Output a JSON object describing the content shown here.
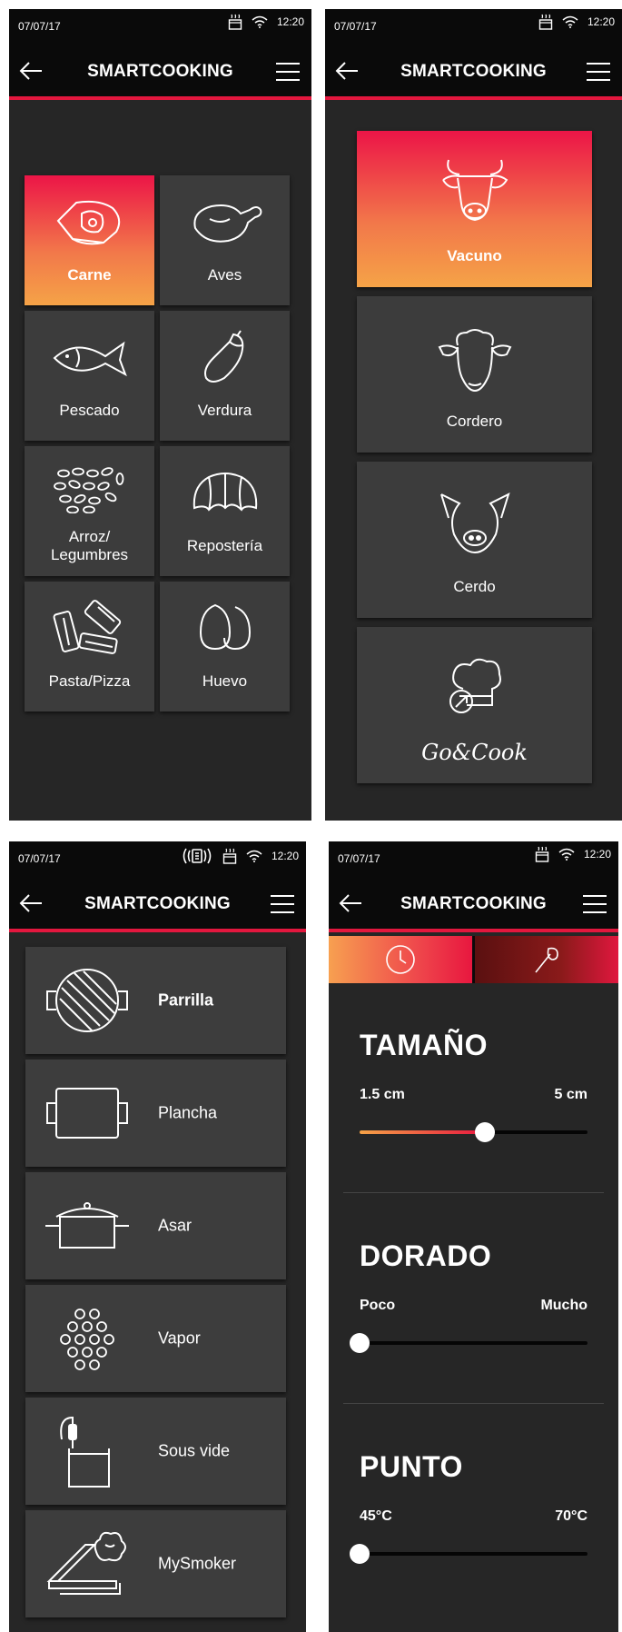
{
  "status": {
    "date": "07/07/17",
    "time": "12:20"
  },
  "appbar": {
    "title": "SMARTCOOKING"
  },
  "categories": {
    "items": [
      {
        "label": "Carne",
        "icon": "meat-icon",
        "selected": true
      },
      {
        "label": "Aves",
        "icon": "chicken-icon"
      },
      {
        "label": "Pescado",
        "icon": "fish-icon"
      },
      {
        "label": "Verdura",
        "icon": "eggplant-icon"
      },
      {
        "label": "Arroz/\nLegumbres",
        "icon": "rice-icon"
      },
      {
        "label": "Repostería",
        "icon": "croissant-icon"
      },
      {
        "label": "Pasta/Pizza",
        "icon": "pasta-icon"
      },
      {
        "label": "Huevo",
        "icon": "egg-icon"
      }
    ]
  },
  "meat_types": {
    "items": [
      {
        "label": "Vacuno",
        "icon": "cow-icon",
        "selected": true
      },
      {
        "label": "Cordero",
        "icon": "sheep-icon"
      },
      {
        "label": "Cerdo",
        "icon": "pig-icon"
      },
      {
        "label": "Go&Cook",
        "icon": "chef-hat-icon"
      }
    ]
  },
  "methods": {
    "items": [
      {
        "label": "Parrilla",
        "icon": "grill-icon",
        "selected": true
      },
      {
        "label": "Plancha",
        "icon": "griddle-icon"
      },
      {
        "label": "Asar",
        "icon": "roasting-pot-icon"
      },
      {
        "label": "Vapor",
        "icon": "steam-icon"
      },
      {
        "label": "Sous vide",
        "icon": "sous-vide-icon"
      },
      {
        "label": "MySmoker",
        "icon": "smoker-icon"
      }
    ]
  },
  "settings": {
    "tabs": [
      {
        "icon": "timer-icon",
        "active": true
      },
      {
        "icon": "probe-icon",
        "active": false
      }
    ],
    "sliders": [
      {
        "title": "TAMAÑO",
        "min": "1.5 cm",
        "max": "5 cm",
        "level": 0.55
      },
      {
        "title": "DORADO",
        "min": "Poco",
        "max": "Mucho",
        "level": 0.0
      },
      {
        "title": "PUNTO",
        "min": "45°C",
        "max": "70°C",
        "level": 0.0
      }
    ]
  },
  "colors": {
    "accent": "#e3173e",
    "gradient_top": "#ec1547",
    "gradient_bottom": "#f5a347",
    "background": "#262626",
    "bar": "#0a0a0a"
  }
}
